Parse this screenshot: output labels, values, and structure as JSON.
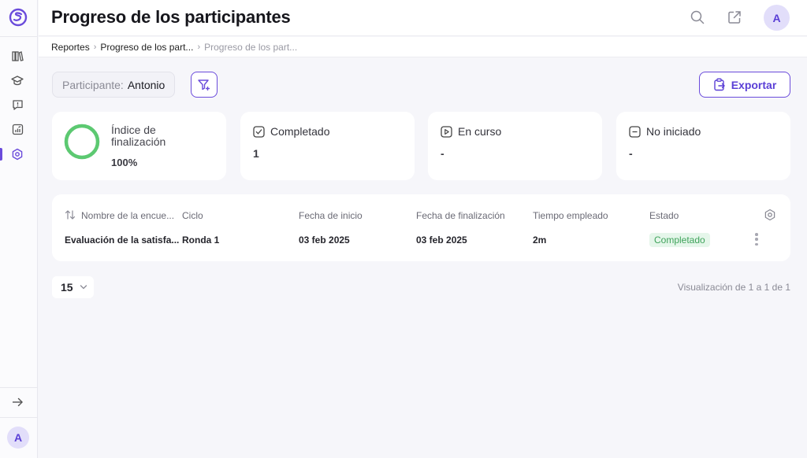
{
  "header": {
    "title": "Progreso de los participantes",
    "avatar_initial": "A"
  },
  "sidebar": {
    "items": [
      {
        "icon": "library-icon"
      },
      {
        "icon": "graduation-cap-icon"
      },
      {
        "icon": "feedback-icon"
      },
      {
        "icon": "reports-icon"
      },
      {
        "icon": "settings-gear-icon",
        "active": true
      }
    ],
    "avatar_initial": "A"
  },
  "breadcrumb": [
    "Reportes",
    "Progreso de los part...",
    "Progreso de los part..."
  ],
  "filter": {
    "label": "Participante:",
    "value": "Antonio"
  },
  "export_label": "Exportar",
  "stats": {
    "completion": {
      "title": "Índice de finalización",
      "value": "100%",
      "percent": 100
    },
    "completed": {
      "label": "Completado",
      "value": "1"
    },
    "in_progress": {
      "label": "En curso",
      "value": "-"
    },
    "not_started": {
      "label": "No iniciado",
      "value": "-"
    }
  },
  "table": {
    "columns": [
      "Nombre de la encue...",
      "Ciclo",
      "Fecha de inicio",
      "Fecha de finalización",
      "Tiempo empleado",
      "Estado"
    ],
    "rows": [
      {
        "name": "Evaluación de la satisfa...",
        "cycle": "Ronda 1",
        "start": "03 feb 2025",
        "end": "03 feb 2025",
        "time": "2m",
        "status": "Completado"
      }
    ]
  },
  "pagination": {
    "page_size": "15",
    "info": "Visualización de 1 a 1 de 1"
  },
  "colors": {
    "accent": "#6a4bdb",
    "success": "#3fa35b",
    "success_bg": "#e5f6ea",
    "ring": "#5cc971"
  }
}
